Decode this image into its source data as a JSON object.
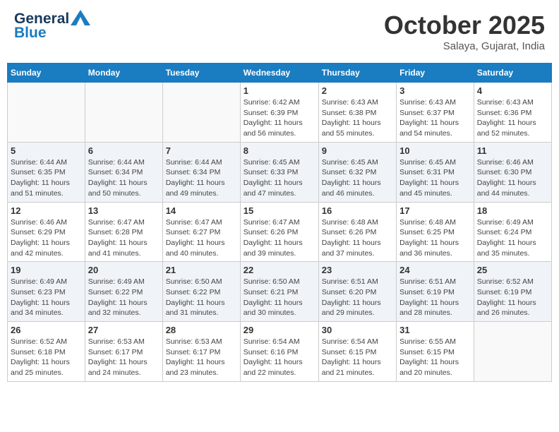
{
  "header": {
    "logo_line1": "General",
    "logo_line2": "Blue",
    "month": "October 2025",
    "location": "Salaya, Gujarat, India"
  },
  "weekdays": [
    "Sunday",
    "Monday",
    "Tuesday",
    "Wednesday",
    "Thursday",
    "Friday",
    "Saturday"
  ],
  "weeks": [
    [
      {
        "day": "",
        "info": ""
      },
      {
        "day": "",
        "info": ""
      },
      {
        "day": "",
        "info": ""
      },
      {
        "day": "1",
        "info": "Sunrise: 6:42 AM\nSunset: 6:39 PM\nDaylight: 11 hours and 56 minutes."
      },
      {
        "day": "2",
        "info": "Sunrise: 6:43 AM\nSunset: 6:38 PM\nDaylight: 11 hours and 55 minutes."
      },
      {
        "day": "3",
        "info": "Sunrise: 6:43 AM\nSunset: 6:37 PM\nDaylight: 11 hours and 54 minutes."
      },
      {
        "day": "4",
        "info": "Sunrise: 6:43 AM\nSunset: 6:36 PM\nDaylight: 11 hours and 52 minutes."
      }
    ],
    [
      {
        "day": "5",
        "info": "Sunrise: 6:44 AM\nSunset: 6:35 PM\nDaylight: 11 hours and 51 minutes."
      },
      {
        "day": "6",
        "info": "Sunrise: 6:44 AM\nSunset: 6:34 PM\nDaylight: 11 hours and 50 minutes."
      },
      {
        "day": "7",
        "info": "Sunrise: 6:44 AM\nSunset: 6:34 PM\nDaylight: 11 hours and 49 minutes."
      },
      {
        "day": "8",
        "info": "Sunrise: 6:45 AM\nSunset: 6:33 PM\nDaylight: 11 hours and 47 minutes."
      },
      {
        "day": "9",
        "info": "Sunrise: 6:45 AM\nSunset: 6:32 PM\nDaylight: 11 hours and 46 minutes."
      },
      {
        "day": "10",
        "info": "Sunrise: 6:45 AM\nSunset: 6:31 PM\nDaylight: 11 hours and 45 minutes."
      },
      {
        "day": "11",
        "info": "Sunrise: 6:46 AM\nSunset: 6:30 PM\nDaylight: 11 hours and 44 minutes."
      }
    ],
    [
      {
        "day": "12",
        "info": "Sunrise: 6:46 AM\nSunset: 6:29 PM\nDaylight: 11 hours and 42 minutes."
      },
      {
        "day": "13",
        "info": "Sunrise: 6:47 AM\nSunset: 6:28 PM\nDaylight: 11 hours and 41 minutes."
      },
      {
        "day": "14",
        "info": "Sunrise: 6:47 AM\nSunset: 6:27 PM\nDaylight: 11 hours and 40 minutes."
      },
      {
        "day": "15",
        "info": "Sunrise: 6:47 AM\nSunset: 6:26 PM\nDaylight: 11 hours and 39 minutes."
      },
      {
        "day": "16",
        "info": "Sunrise: 6:48 AM\nSunset: 6:26 PM\nDaylight: 11 hours and 37 minutes."
      },
      {
        "day": "17",
        "info": "Sunrise: 6:48 AM\nSunset: 6:25 PM\nDaylight: 11 hours and 36 minutes."
      },
      {
        "day": "18",
        "info": "Sunrise: 6:49 AM\nSunset: 6:24 PM\nDaylight: 11 hours and 35 minutes."
      }
    ],
    [
      {
        "day": "19",
        "info": "Sunrise: 6:49 AM\nSunset: 6:23 PM\nDaylight: 11 hours and 34 minutes."
      },
      {
        "day": "20",
        "info": "Sunrise: 6:49 AM\nSunset: 6:22 PM\nDaylight: 11 hours and 32 minutes."
      },
      {
        "day": "21",
        "info": "Sunrise: 6:50 AM\nSunset: 6:22 PM\nDaylight: 11 hours and 31 minutes."
      },
      {
        "day": "22",
        "info": "Sunrise: 6:50 AM\nSunset: 6:21 PM\nDaylight: 11 hours and 30 minutes."
      },
      {
        "day": "23",
        "info": "Sunrise: 6:51 AM\nSunset: 6:20 PM\nDaylight: 11 hours and 29 minutes."
      },
      {
        "day": "24",
        "info": "Sunrise: 6:51 AM\nSunset: 6:19 PM\nDaylight: 11 hours and 28 minutes."
      },
      {
        "day": "25",
        "info": "Sunrise: 6:52 AM\nSunset: 6:19 PM\nDaylight: 11 hours and 26 minutes."
      }
    ],
    [
      {
        "day": "26",
        "info": "Sunrise: 6:52 AM\nSunset: 6:18 PM\nDaylight: 11 hours and 25 minutes."
      },
      {
        "day": "27",
        "info": "Sunrise: 6:53 AM\nSunset: 6:17 PM\nDaylight: 11 hours and 24 minutes."
      },
      {
        "day": "28",
        "info": "Sunrise: 6:53 AM\nSunset: 6:17 PM\nDaylight: 11 hours and 23 minutes."
      },
      {
        "day": "29",
        "info": "Sunrise: 6:54 AM\nSunset: 6:16 PM\nDaylight: 11 hours and 22 minutes."
      },
      {
        "day": "30",
        "info": "Sunrise: 6:54 AM\nSunset: 6:15 PM\nDaylight: 11 hours and 21 minutes."
      },
      {
        "day": "31",
        "info": "Sunrise: 6:55 AM\nSunset: 6:15 PM\nDaylight: 11 hours and 20 minutes."
      },
      {
        "day": "",
        "info": ""
      }
    ]
  ]
}
